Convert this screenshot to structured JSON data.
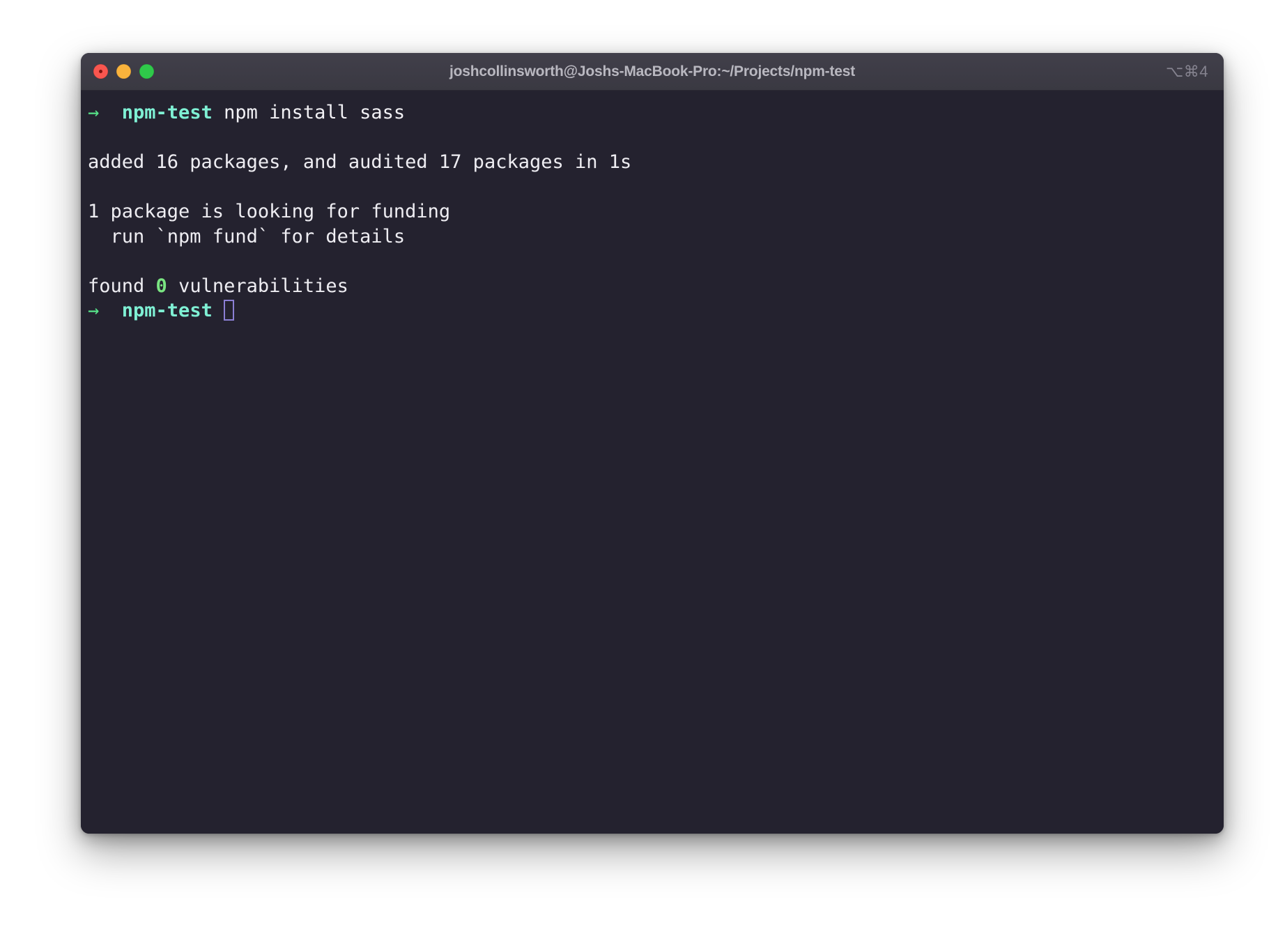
{
  "window": {
    "title": "joshcollinsworth@Joshs-MacBook-Pro:~/Projects/npm-test",
    "shortcut_hint": "⌥⌘4",
    "traffic_lights": {
      "close_label": "close-window",
      "minimize_label": "minimize-window",
      "maximize_label": "maximize-window"
    }
  },
  "colors": {
    "window_chrome": "#3a3942",
    "terminal_background": "#24222f",
    "title_text": "#b9b8c0",
    "prompt_arrow": "#57e389",
    "prompt_dir": "#7ff0d4",
    "output_text": "#eeedf2",
    "success_number": "#7ae582",
    "cursor_outline": "#8b7fd4",
    "traffic_close": "#f9564f",
    "traffic_minimize": "#f9b33c",
    "traffic_maximize": "#2fc94a"
  },
  "terminal": {
    "lines": [
      {
        "id": "command-line",
        "segments": [
          {
            "text": "→",
            "style": "prompt-arrow"
          },
          {
            "text": "  ",
            "style": "plain"
          },
          {
            "text": "npm-test",
            "style": "dir"
          },
          {
            "text": " npm install sass",
            "style": "cmd"
          }
        ]
      },
      {
        "id": "blank-1",
        "segments": [
          {
            "text": " ",
            "style": "plain"
          }
        ]
      },
      {
        "id": "added-packages-line",
        "segments": [
          {
            "text": "added 16 packages, and audited 17 packages in 1s",
            "style": "plain"
          }
        ]
      },
      {
        "id": "blank-2",
        "segments": [
          {
            "text": " ",
            "style": "plain"
          }
        ]
      },
      {
        "id": "funding-line",
        "segments": [
          {
            "text": "1 package is looking for funding",
            "style": "plain"
          }
        ]
      },
      {
        "id": "funding-detail-line",
        "segments": [
          {
            "text": "  run `npm fund` for details",
            "style": "plain"
          }
        ]
      },
      {
        "id": "blank-3",
        "segments": [
          {
            "text": " ",
            "style": "plain"
          }
        ]
      },
      {
        "id": "vulnerabilities-line",
        "segments": [
          {
            "text": "found ",
            "style": "plain"
          },
          {
            "text": "0",
            "style": "green-bold"
          },
          {
            "text": " vulnerabilities",
            "style": "plain"
          }
        ]
      },
      {
        "id": "prompt-line",
        "segments": [
          {
            "text": "→",
            "style": "prompt-arrow"
          },
          {
            "text": "  ",
            "style": "plain"
          },
          {
            "text": "npm-test",
            "style": "dir"
          },
          {
            "text": " ",
            "style": "plain"
          },
          {
            "text": "",
            "style": "cursor"
          }
        ]
      }
    ]
  }
}
